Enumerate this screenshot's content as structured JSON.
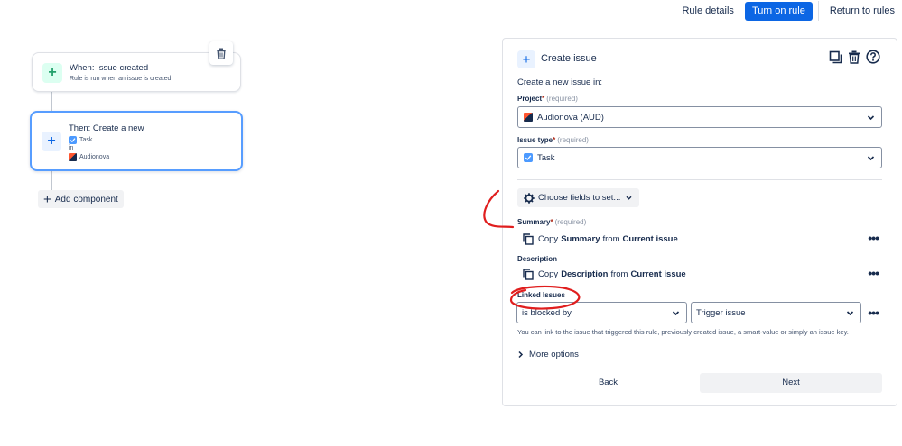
{
  "topbar": {
    "rule_details": "Rule details",
    "turn_on": "Turn on rule",
    "return": "Return to rules"
  },
  "workflow": {
    "trigger": {
      "title": "When: Issue created",
      "subtitle": "Rule is run when an issue is created."
    },
    "action": {
      "title": "Then: Create a new",
      "issue_type": "Task",
      "in_label": "in",
      "project": "Audionova"
    },
    "add_component": "Add component"
  },
  "panel": {
    "title": "Create issue",
    "intro": "Create a new issue in:",
    "project": {
      "label": "Project",
      "required_star": "*",
      "required_hint": "(required)",
      "value": "Audionova (AUD)"
    },
    "issue_type": {
      "label": "Issue type",
      "required_star": "*",
      "required_hint": "(required)",
      "value": "Task"
    },
    "choose_fields": "Choose fields to set...",
    "summary": {
      "label": "Summary",
      "required_star": "*",
      "required_hint": "(required)",
      "copy_word": "Copy",
      "field": "Summary",
      "from_word": "from",
      "source": "Current issue"
    },
    "description": {
      "label": "Description",
      "copy_word": "Copy",
      "field": "Description",
      "from_word": "from",
      "source": "Current issue"
    },
    "linked_issues": {
      "label": "Linked Issues",
      "link_type": "is blocked by",
      "target": "Trigger issue",
      "helper": "You can link to the issue that triggered this rule, previously created issue, a smart-value or simply an issue key."
    },
    "more_options": "More options",
    "back": "Back",
    "next": "Next"
  },
  "colors": {
    "primary": "#0c66e4",
    "annotation": "#e01e1e",
    "selected_border": "#579dff"
  }
}
